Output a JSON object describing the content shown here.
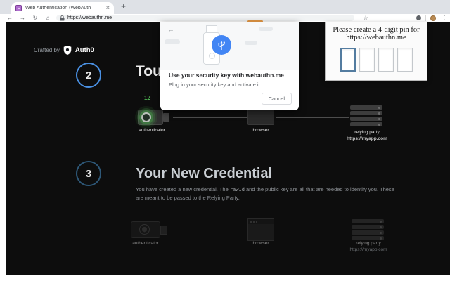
{
  "window": {
    "tab_title": "Web Authentication (WebAuth",
    "close_tab_icon": "×",
    "new_tab_icon": "+",
    "toolbar": {
      "back_icon": "←",
      "forward_icon": "→",
      "reload_icon": "↻",
      "home_icon": "⌂",
      "url": "https://webauthn.me",
      "bookmark_icon": "☆",
      "menu_icon": "⋮"
    }
  },
  "page": {
    "crafted_by_label": "Crafted by",
    "brand_name": "Auth0",
    "steps": {
      "step2_number": "2",
      "step2_heading_visible": "Touc",
      "countdown": "12",
      "step3_number": "3",
      "step3_heading": "Your New Credential",
      "step3_text_before": "You have created a new credential. The ",
      "step3_text_code": "rawId",
      "step3_text_after": " and the public key are all that are needed to identify you. These are meant to be passed to the Relying Party."
    },
    "diagram_labels": {
      "authenticator": "authenticator",
      "browser": "browser",
      "relying_party": "relying party",
      "relying_party_url": "https://myapp.com"
    }
  },
  "security_key_dialog": {
    "back_icon": "←",
    "title": "Use your security key with webauthn.me",
    "subtitle": "Plug in your security key and activate it.",
    "cancel_label": "Cancel"
  },
  "pin_dialog": {
    "prompt_line1": "Please create a 4-digit pin for",
    "prompt_line2": "https://webauthn.me",
    "digit_count": 4
  },
  "colors": {
    "accent_blue": "#4a90e2",
    "countdown_green": "#4caf50",
    "security_key_blue": "#4285f4",
    "progress_orange": "#d08a3e",
    "page_background": "#0d0d0d"
  }
}
